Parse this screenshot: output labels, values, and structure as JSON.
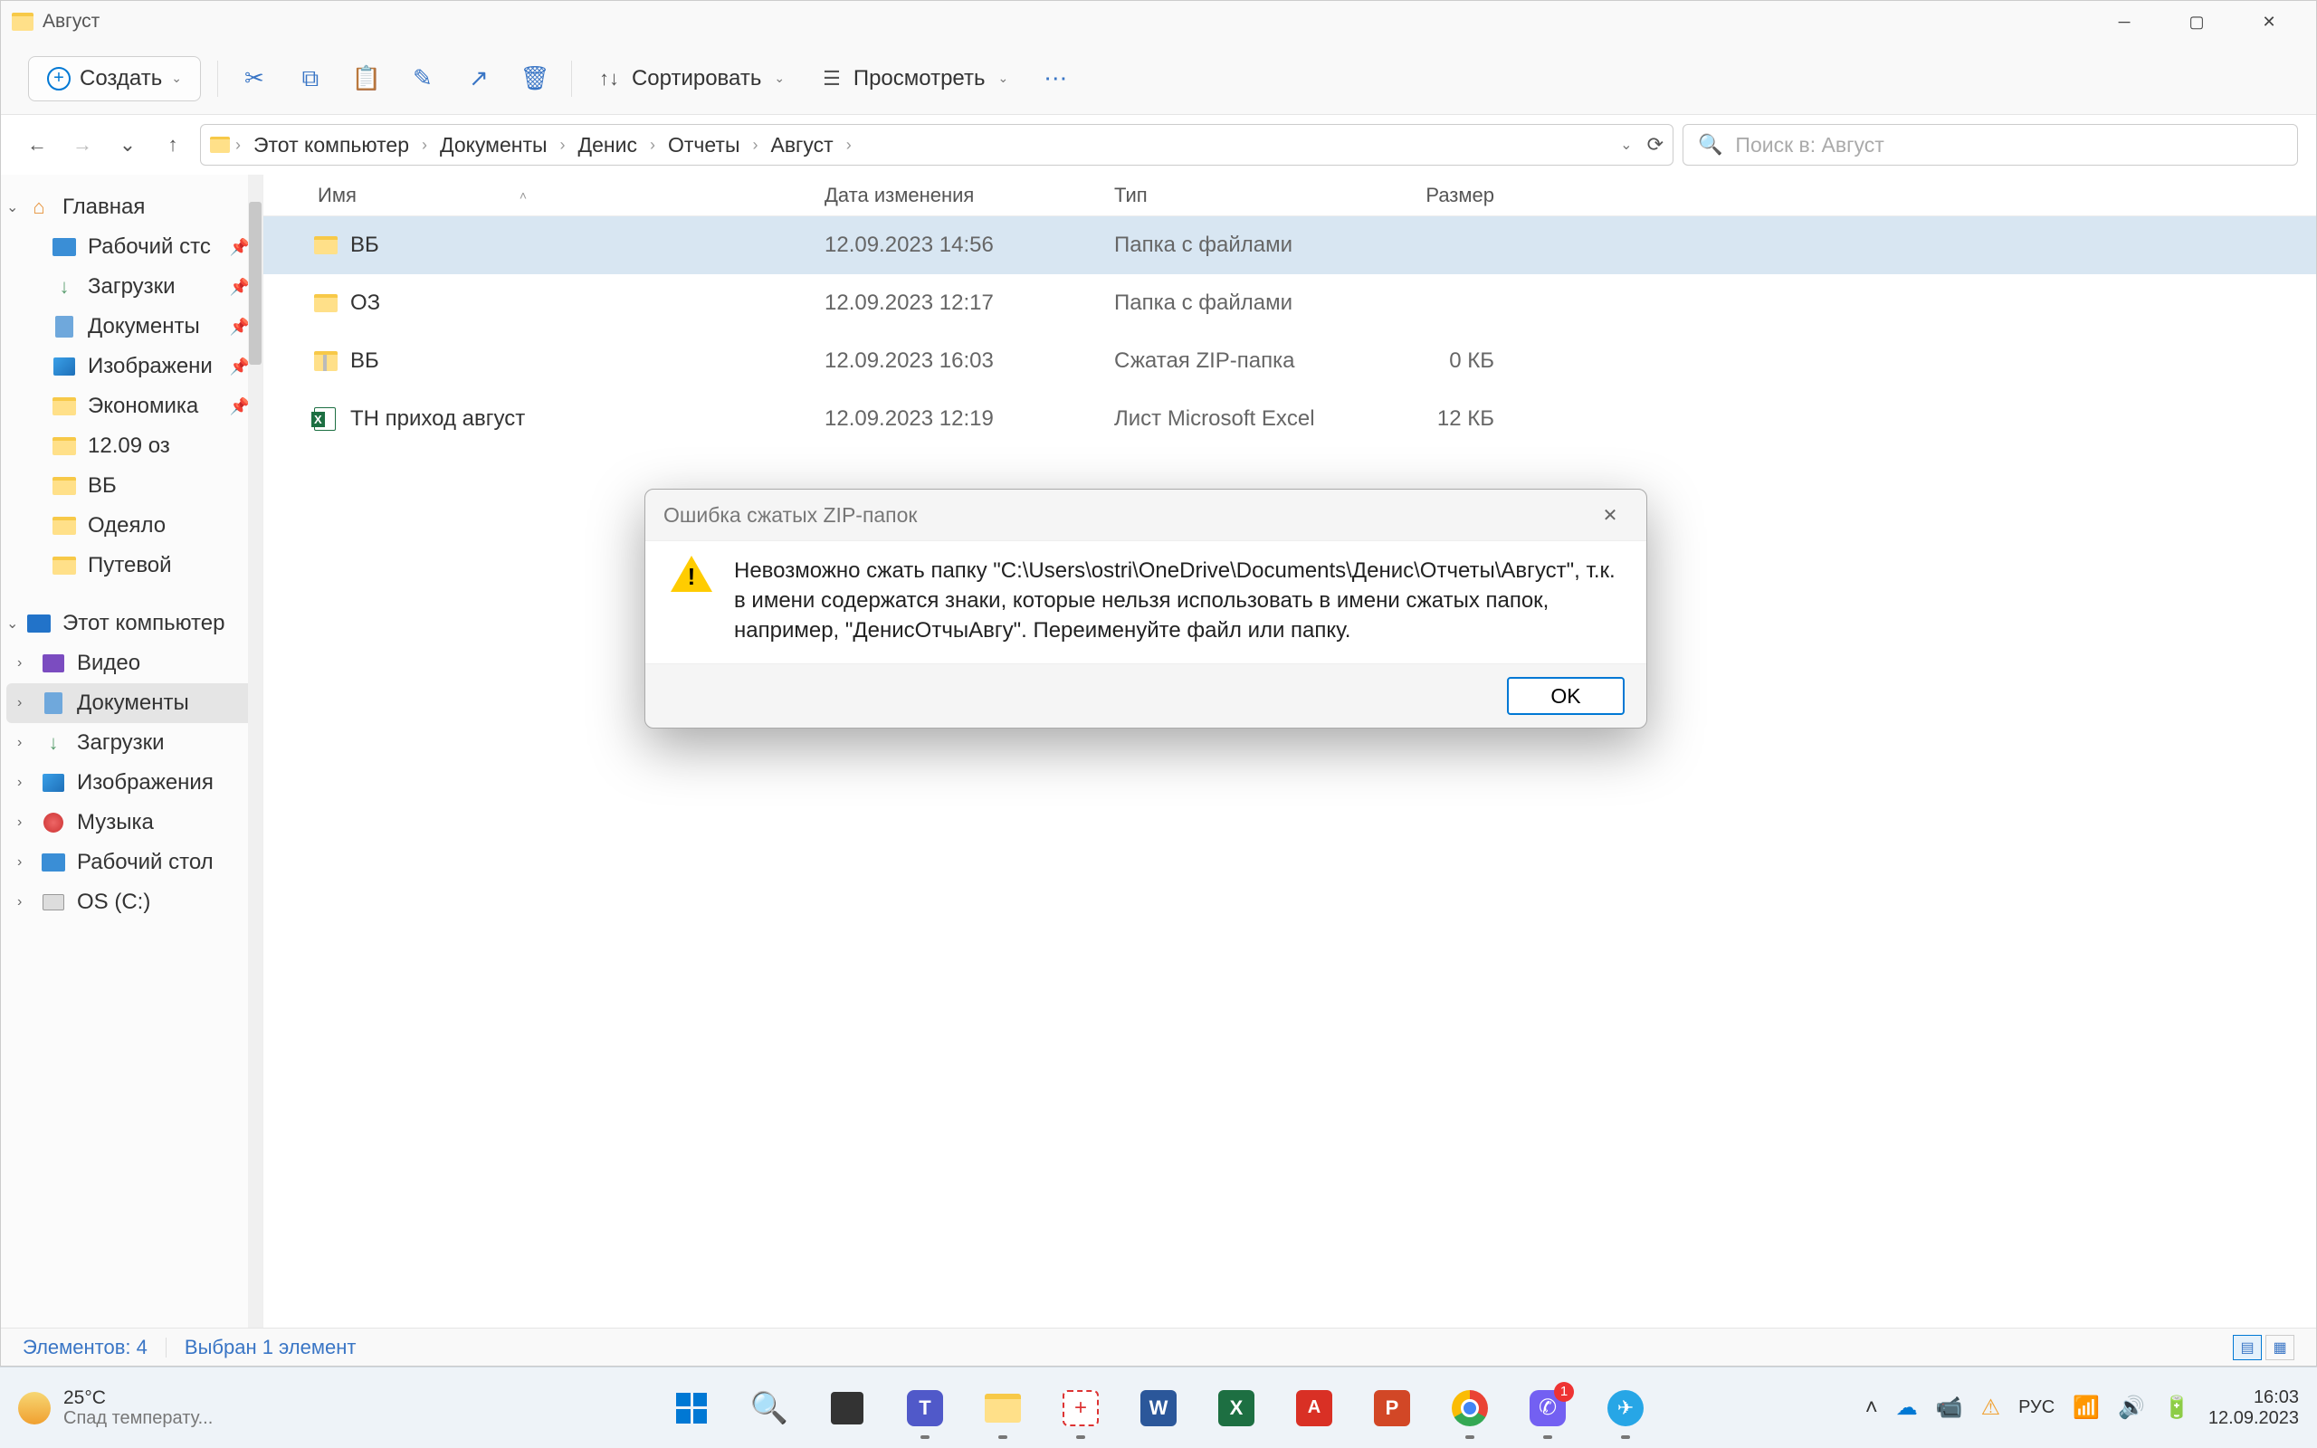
{
  "window": {
    "title": "Август"
  },
  "toolbar": {
    "new": "Создать",
    "sort": "Сортировать",
    "view": "Просмотреть"
  },
  "breadcrumb": {
    "items": [
      "Этот компьютер",
      "Документы",
      "Денис",
      "Отчеты",
      "Август"
    ]
  },
  "search": {
    "placeholder": "Поиск в: Август"
  },
  "sidebar": {
    "home": "Главная",
    "quick": [
      {
        "label": "Рабочий стс"
      },
      {
        "label": "Загрузки"
      },
      {
        "label": "Документы"
      },
      {
        "label": "Изображени"
      },
      {
        "label": "Экономика"
      },
      {
        "label": "12.09 оз"
      },
      {
        "label": "ВБ"
      },
      {
        "label": "Одеяло"
      },
      {
        "label": "Путевой"
      }
    ],
    "this_pc": "Этот компьютер",
    "pc_items": [
      {
        "label": "Видео"
      },
      {
        "label": "Документы"
      },
      {
        "label": "Загрузки"
      },
      {
        "label": "Изображения"
      },
      {
        "label": "Музыка"
      },
      {
        "label": "Рабочий стол"
      },
      {
        "label": "OS (C:)"
      }
    ]
  },
  "columns": {
    "name": "Имя",
    "date": "Дата изменения",
    "type": "Тип",
    "size": "Размер"
  },
  "files": [
    {
      "name": "ВБ",
      "date": "12.09.2023 14:56",
      "type": "Папка с файлами",
      "size": ""
    },
    {
      "name": "ОЗ",
      "date": "12.09.2023 12:17",
      "type": "Папка с файлами",
      "size": ""
    },
    {
      "name": "ВБ",
      "date": "12.09.2023 16:03",
      "type": "Сжатая ZIP-папка",
      "size": "0 КБ"
    },
    {
      "name": "ТН приход август",
      "date": "12.09.2023 12:19",
      "type": "Лист Microsoft Excel",
      "size": "12 КБ"
    }
  ],
  "status": {
    "count": "Элементов: 4",
    "selected": "Выбран 1 элемент"
  },
  "dialog": {
    "title": "Ошибка сжатых ZIP-папок",
    "message": "Невозможно сжать папку \"C:\\Users\\ostri\\OneDrive\\Documents\\Денис\\Отчеты\\Август\", т.к. в имени содержатся знаки, которые нельзя использовать в имени сжатых папок, например, \"ДенисОтчыАвгу\". Переименуйте файл или папку.",
    "ok": "OK"
  },
  "taskbar": {
    "weather_temp": "25°C",
    "weather_desc": "Спад температу...",
    "lang": "РУС",
    "time": "16:03",
    "date": "12.09.2023",
    "viber_badge": "1"
  }
}
